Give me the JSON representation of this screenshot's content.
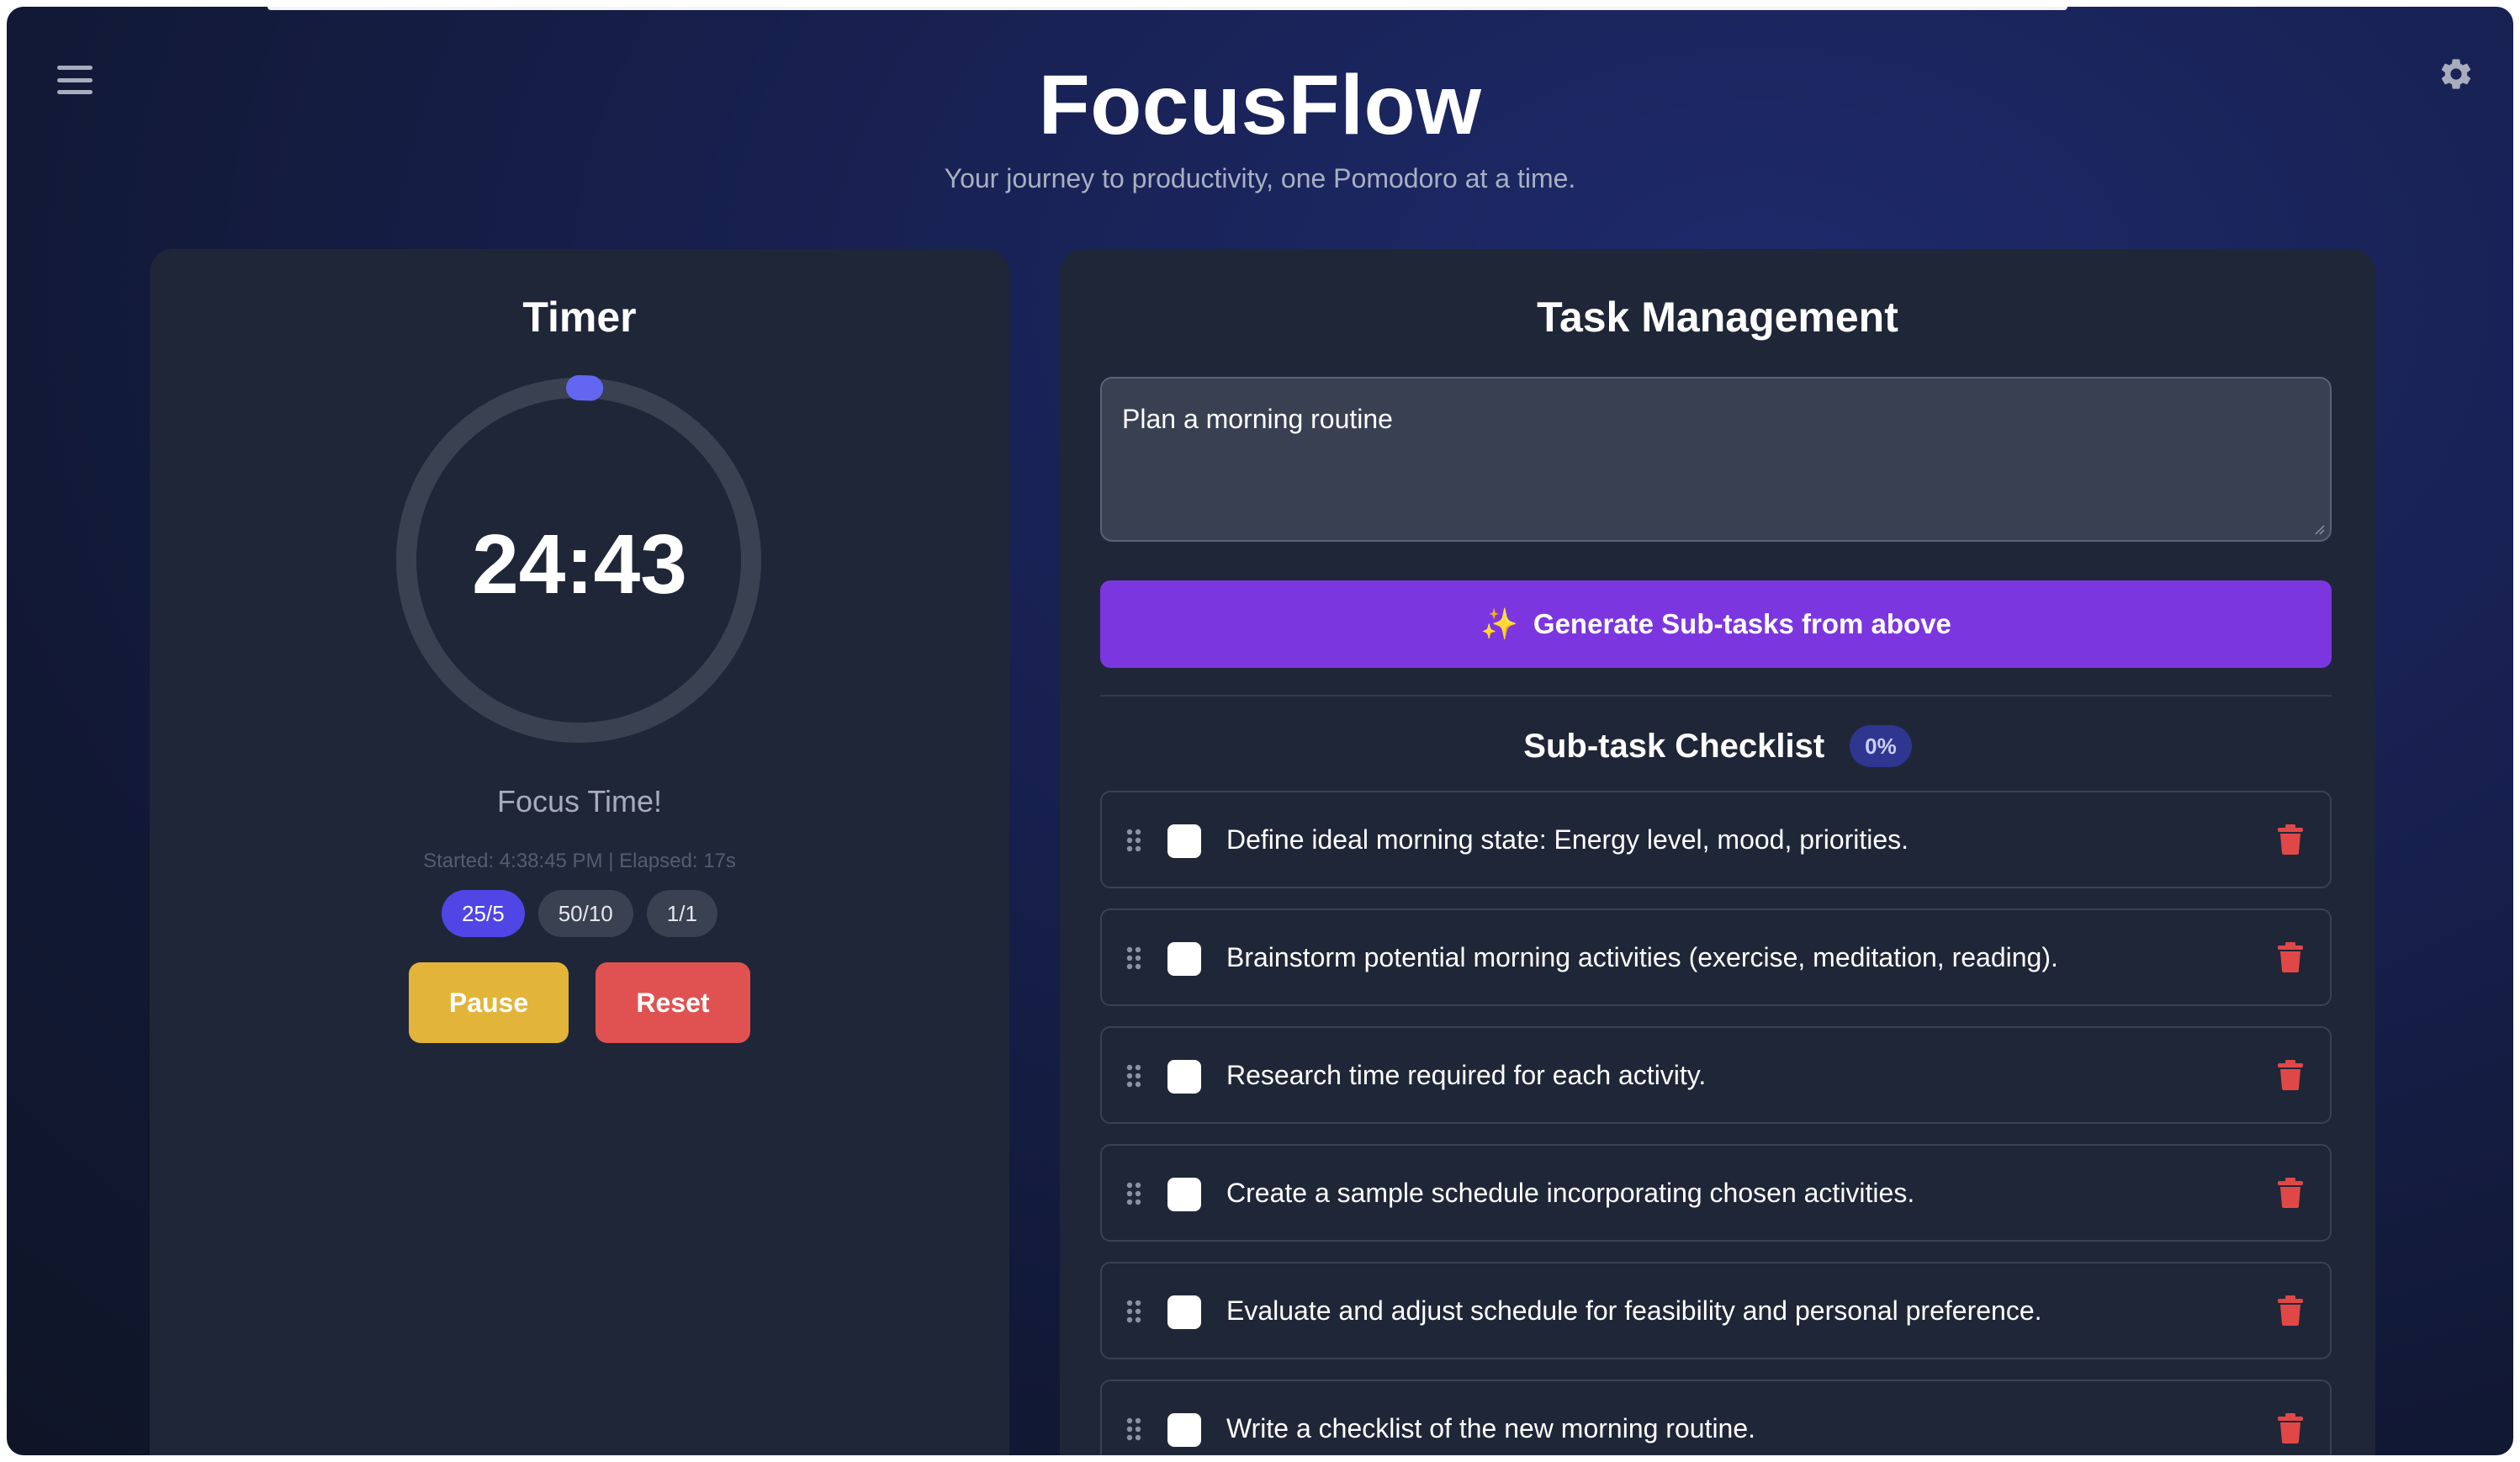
{
  "app": {
    "title": "FocusFlow",
    "subtitle": "Your journey to productivity, one Pomodoro at a time."
  },
  "header": {
    "menu_icon": "menu-icon",
    "settings_icon": "gear-icon"
  },
  "timer": {
    "title": "Timer",
    "time": "24:43",
    "mode": "Focus Time!",
    "meta": "Started: 4:38:45 PM | Elapsed: 17s",
    "progress": 0.011,
    "presets": [
      {
        "label": "25/5",
        "active": true
      },
      {
        "label": "50/10",
        "active": false
      },
      {
        "label": "1/1",
        "active": false
      }
    ],
    "pause_label": "Pause",
    "reset_label": "Reset"
  },
  "tasks": {
    "title": "Task Management",
    "input_value": "Plan a morning routine",
    "generate_icon": "sparkles-icon",
    "generate_label": "Generate Sub-tasks from above",
    "checklist_title": "Sub-task Checklist",
    "progress_badge": "0%",
    "items": [
      {
        "text": "Define ideal morning state: Energy level, mood, priorities.",
        "checked": false
      },
      {
        "text": "Brainstorm potential morning activities (exercise, meditation, reading).",
        "checked": false
      },
      {
        "text": "Research time required for each activity.",
        "checked": false
      },
      {
        "text": "Create a sample schedule incorporating chosen activities.",
        "checked": false
      },
      {
        "text": "Evaluate and adjust schedule for feasibility and personal preference.",
        "checked": false
      },
      {
        "text": "Write a checklist of the new morning routine.",
        "checked": false
      }
    ]
  },
  "colors": {
    "accent_indigo": "#4f46e5",
    "ring_dot": "#6366f1",
    "generate_purple": "#7c36e0",
    "pause_yellow": "#e2b43a",
    "reset_red": "#e05252",
    "trash_red": "#e04848"
  }
}
